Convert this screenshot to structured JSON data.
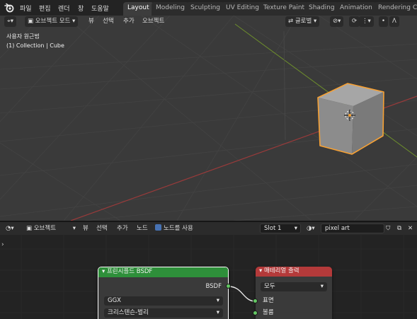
{
  "top_menu": {
    "items": [
      "파일",
      "편집",
      "렌더",
      "창",
      "도움말"
    ]
  },
  "workspace_tabs": [
    "Layout",
    "Modeling",
    "Sculpting",
    "UV Editing",
    "Texture Paint",
    "Shading",
    "Animation",
    "Rendering",
    "C"
  ],
  "viewport": {
    "mode": "오브젝트 모드",
    "menus": [
      "뷰",
      "선택",
      "추가",
      "오브젝트"
    ],
    "transform_orientation": "글로벌",
    "view_name": "사용자 원근법",
    "collection_info": "(1) Collection | Cube"
  },
  "node_editor": {
    "editor_type": "오브젝트",
    "menus": [
      "뷰",
      "선택",
      "추가",
      "노드"
    ],
    "use_nodes_label": "노드를 사용",
    "slot": "Slot 1",
    "material_name": "pixel art",
    "nodes": {
      "bsdf": {
        "title": "프린시플드 BSDF",
        "output_label": "BSDF",
        "distribution": "GGX",
        "subsurface_method": "크리스텐슨-벌리"
      },
      "output": {
        "title": "매테리얼 출력",
        "target": "모두",
        "input_surface": "표면",
        "input_volume": "볼륨"
      }
    }
  },
  "colors": {
    "accent": "#4772b3",
    "selection_outline": "#f7a134",
    "shader_header": "#2e8f3a",
    "output_header": "#b43a3a",
    "socket_shader": "#63c763"
  }
}
